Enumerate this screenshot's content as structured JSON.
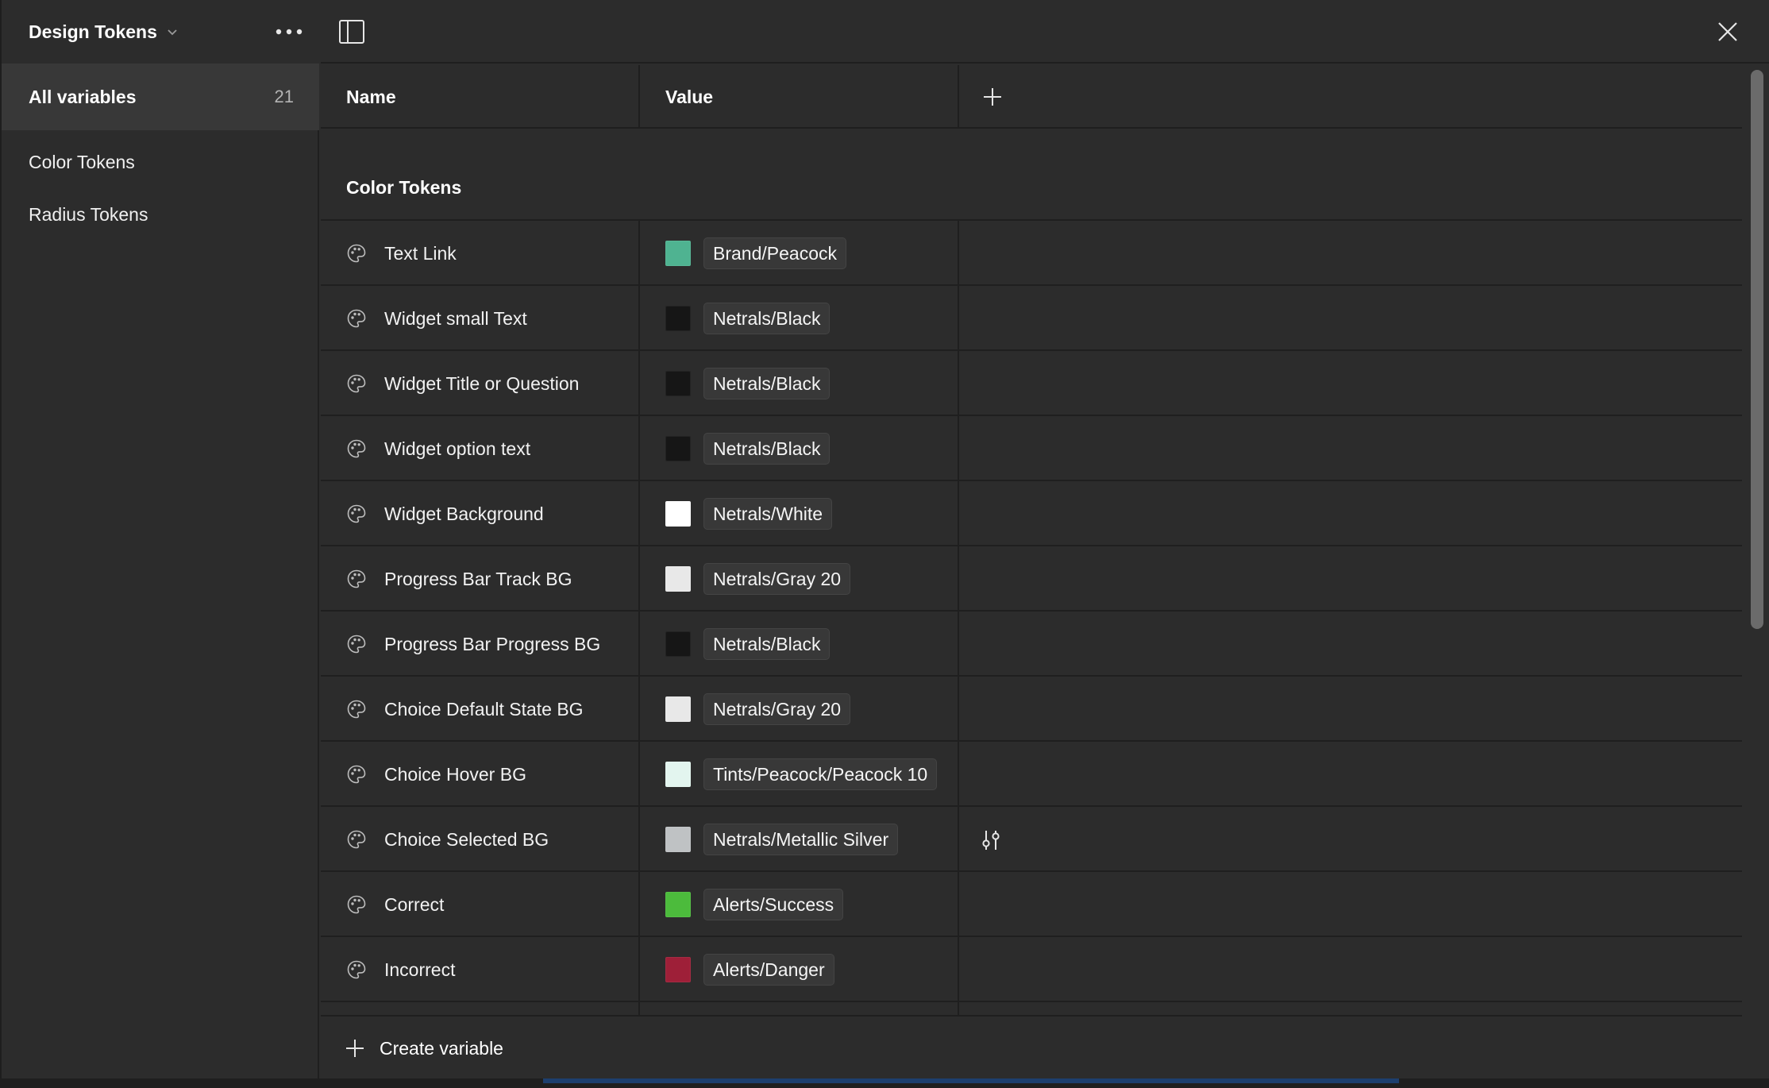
{
  "sidebar": {
    "collection_title": "Design Tokens",
    "all_variables": {
      "label": "All variables",
      "count": "21"
    },
    "groups": [
      "Color Tokens",
      "Radius Tokens"
    ]
  },
  "table": {
    "headers": {
      "name": "Name",
      "value": "Value"
    },
    "group_title": "Color Tokens",
    "rows": [
      {
        "name": "Text Link",
        "value": "Brand/Peacock",
        "swatch": "#4fb391"
      },
      {
        "name": "Widget small Text",
        "value": "Netrals/Black",
        "swatch": "#161616"
      },
      {
        "name": "Widget Title or Question",
        "value": "Netrals/Black",
        "swatch": "#161616"
      },
      {
        "name": "Widget option text",
        "value": "Netrals/Black",
        "swatch": "#161616"
      },
      {
        "name": "Widget Background",
        "value": "Netrals/White",
        "swatch": "#ffffff"
      },
      {
        "name": "Progress Bar Track BG",
        "value": "Netrals/Gray 20",
        "swatch": "#e8e8e8"
      },
      {
        "name": "Progress Bar Progress BG",
        "value": "Netrals/Black",
        "swatch": "#161616"
      },
      {
        "name": "Choice Default State BG",
        "value": "Netrals/Gray 20",
        "swatch": "#e8e8e8"
      },
      {
        "name": "Choice Hover BG",
        "value": "Tints/Peacock/Peacock 10",
        "swatch": "#e3f5ef"
      },
      {
        "name": "Choice Selected BG",
        "value": "Netrals/Metallic Silver",
        "swatch": "#bfc2c4",
        "hovered": true
      },
      {
        "name": "Correct",
        "value": "Alerts/Success",
        "swatch": "#4cbb3c"
      },
      {
        "name": "Incorrect",
        "value": "Alerts/Danger",
        "swatch": "#9e1f38"
      }
    ],
    "create_label": "Create variable"
  },
  "icons": {
    "chevron": "chevron-down-icon",
    "more": "more-icon",
    "panel": "sidebar-toggle-icon",
    "close": "close-icon",
    "add": "plus-icon",
    "palette": "palette-icon",
    "adjust": "adjust-icon"
  }
}
